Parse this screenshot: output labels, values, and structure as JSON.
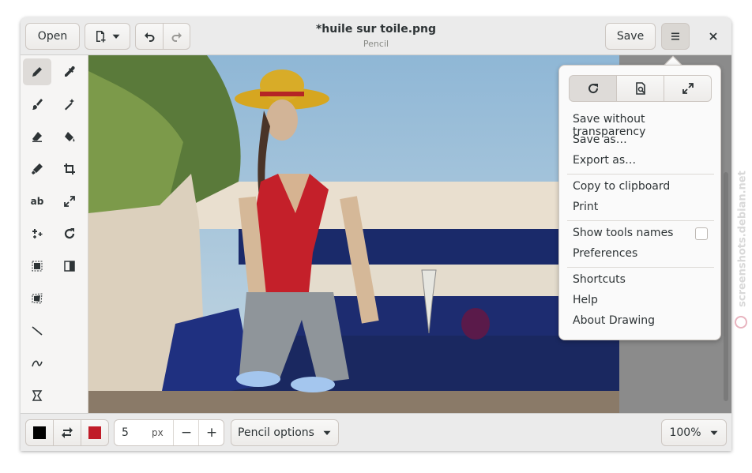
{
  "header": {
    "open_label": "Open",
    "save_label": "Save",
    "title": "*huile sur toile.png",
    "subtitle": "Pencil",
    "icons": [
      "new-image-icon",
      "chevron-down-icon",
      "undo-icon",
      "redo-icon",
      "hamburger-menu-icon",
      "close-icon"
    ]
  },
  "tools": [
    {
      "name": "pencil",
      "icon": "pencil-icon",
      "active": true
    },
    {
      "name": "color-picker",
      "icon": "eyedropper-icon"
    },
    {
      "name": "brush",
      "icon": "brush-icon"
    },
    {
      "name": "select",
      "icon": "magic-wand-icon"
    },
    {
      "name": "eraser",
      "icon": "eraser-icon"
    },
    {
      "name": "paint",
      "icon": "paint-bucket-icon"
    },
    {
      "name": "highlighter",
      "icon": "highlighter-icon"
    },
    {
      "name": "crop",
      "icon": "crop-icon"
    },
    {
      "name": "text",
      "icon": "text-icon",
      "text": "ab"
    },
    {
      "name": "scale",
      "icon": "scale-icon"
    },
    {
      "name": "points",
      "icon": "points-icon"
    },
    {
      "name": "rotate",
      "icon": "rotate-icon"
    },
    {
      "name": "rect-select",
      "icon": "rect-select-icon"
    },
    {
      "name": "filters",
      "icon": "filters-icon"
    },
    {
      "name": "free-select",
      "icon": "free-select-icon"
    },
    {
      "name": "line",
      "icon": "line-icon"
    },
    {
      "name": "curve",
      "icon": "curve-icon"
    },
    {
      "name": "shape",
      "icon": "shape-icon"
    }
  ],
  "menu": {
    "segment_icons": [
      "reload-icon",
      "image-properties-icon",
      "fullscreen-icon"
    ],
    "items": [
      "Save without transparency",
      "Save as…",
      "Export as…",
      "Copy to clipboard",
      "Print",
      "Show tools names",
      "Preferences",
      "Shortcuts",
      "Help",
      "About Drawing"
    ],
    "show_tools_names_checked": false
  },
  "bottom": {
    "main_color": "#000000",
    "secondary_color": "#c01c28",
    "size_value": "5",
    "size_unit": "px",
    "minus": "−",
    "plus": "+",
    "options_label": "Pencil options",
    "zoom_label": "100%"
  },
  "watermark": "screenshots.debian.net"
}
